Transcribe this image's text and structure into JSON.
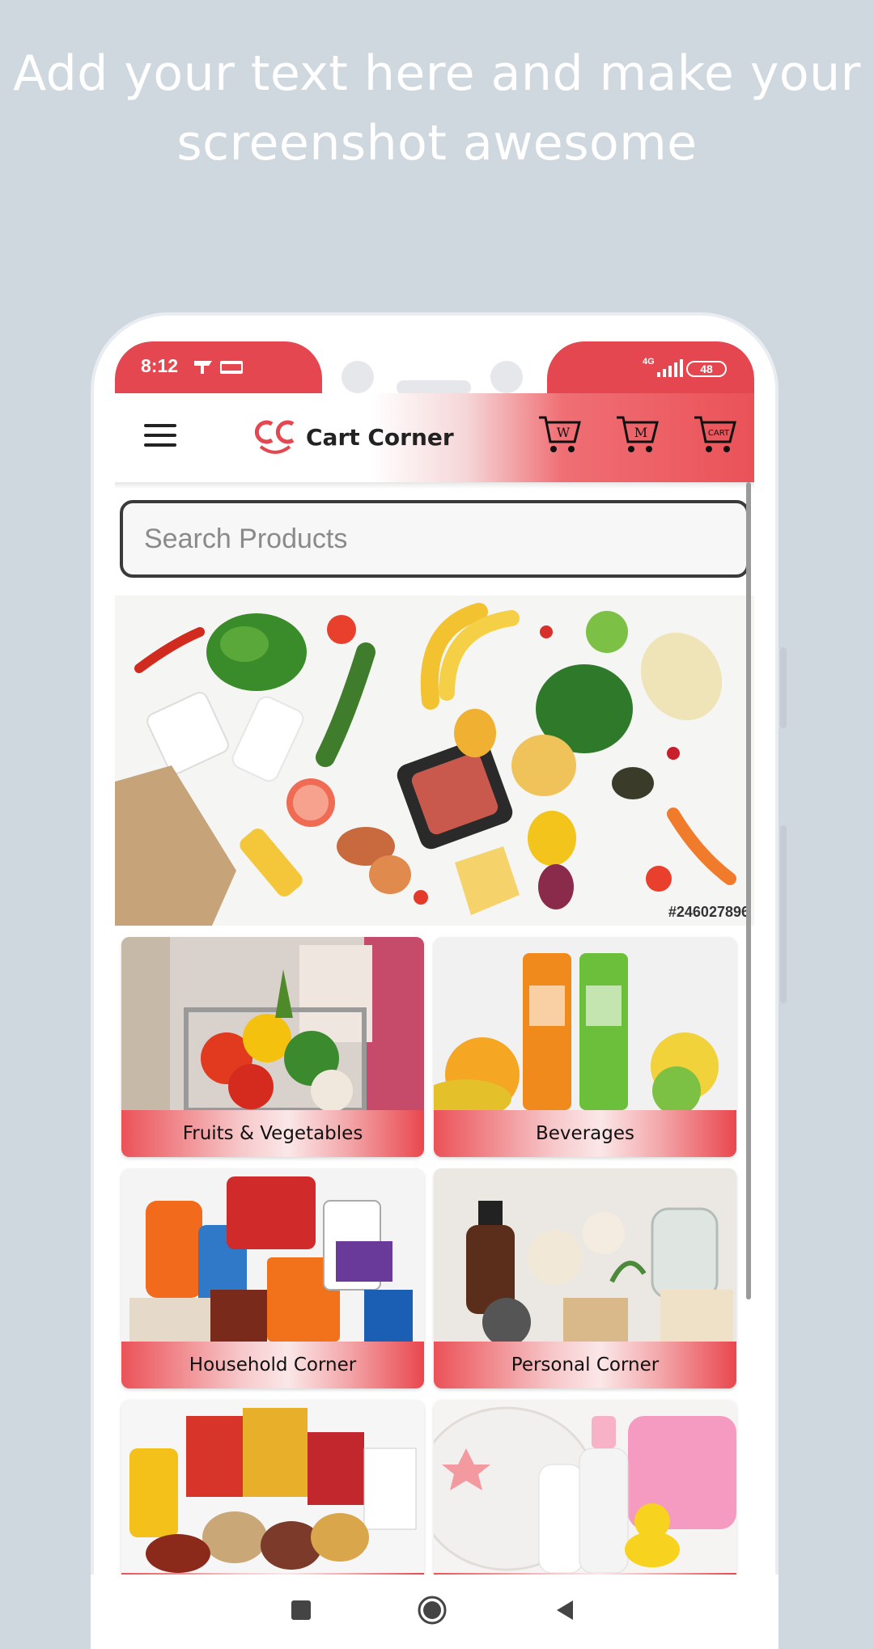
{
  "promo": {
    "line1": "Add your text here and make your",
    "line2": "screenshot awesome"
  },
  "status_bar": {
    "time": "8:12",
    "network": "4G",
    "battery": "48",
    "icons": [
      "notification-icon",
      "oyo-app-icon",
      "signal-icon",
      "battery-icon"
    ]
  },
  "app_bar": {
    "brand": "Cart Corner",
    "menu_icon": "hamburger-menu-icon",
    "carts": [
      {
        "icon": "cart-icon",
        "badge": "W"
      },
      {
        "icon": "cart-icon",
        "badge": "M"
      },
      {
        "icon": "cart-icon",
        "badge": "CART"
      }
    ]
  },
  "search": {
    "placeholder": "Search Products"
  },
  "banner": {
    "stock_id": "#246027896"
  },
  "categories": [
    {
      "label": "Fruits & Vegetables"
    },
    {
      "label": "Beverages"
    },
    {
      "label": "Household Corner"
    },
    {
      "label": "Personal Corner"
    },
    {
      "label": ""
    },
    {
      "label": ""
    }
  ],
  "colors": {
    "accent": "#e4474f",
    "background": "#cfd7df"
  }
}
